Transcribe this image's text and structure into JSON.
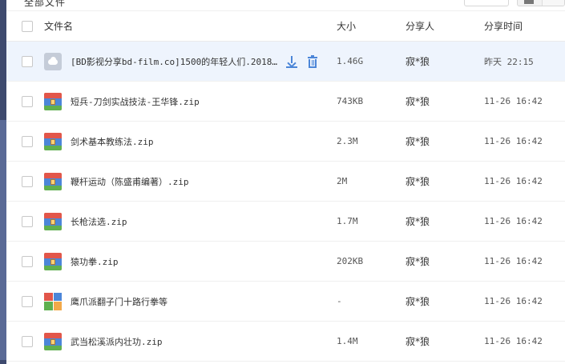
{
  "top": {
    "clipped_title": "全部文件"
  },
  "header": {
    "name": "文件名",
    "size": "大小",
    "sharer": "分享人",
    "time": "分享时间"
  },
  "rows": [
    {
      "icon": "cloud-file-icon",
      "name": "[BD影视分享bd-film.co]1500的年轻人们.2018…",
      "size": "1.46G",
      "sharer": "寂*狼",
      "time": "昨天 22:15"
    },
    {
      "icon": "zip-file-icon",
      "name": "短兵-刀剑实战技法-王华锋.zip",
      "size": "743KB",
      "sharer": "寂*狼",
      "time": "11-26 16:42"
    },
    {
      "icon": "zip-file-icon",
      "name": "剑术基本教练法.zip",
      "size": "2.3M",
      "sharer": "寂*狼",
      "time": "11-26 16:42"
    },
    {
      "icon": "zip-file-icon",
      "name": "鞭杆运动（陈盛甫编著）.zip",
      "size": "2M",
      "sharer": "寂*狼",
      "time": "11-26 16:42"
    },
    {
      "icon": "zip-file-icon",
      "name": "长枪法选.zip",
      "size": "1.7M",
      "sharer": "寂*狼",
      "time": "11-26 16:42"
    },
    {
      "icon": "zip-file-icon",
      "name": "猿功拳.zip",
      "size": "202KB",
      "sharer": "寂*狼",
      "time": "11-26 16:42"
    },
    {
      "icon": "multi-app-icon",
      "name": "鹰爪派翻子门十路行拳等",
      "size": "-",
      "sharer": "寂*狼",
      "time": "11-26 16:42"
    },
    {
      "icon": "zip-file-icon",
      "name": "武当松溪派内壮功.zip",
      "size": "1.4M",
      "sharer": "寂*狼",
      "time": "11-26 16:42"
    }
  ],
  "colors": {
    "accent": "#4c86d8",
    "highlight_row": "#eef4fd",
    "sidebar": "#3e4a6e"
  }
}
